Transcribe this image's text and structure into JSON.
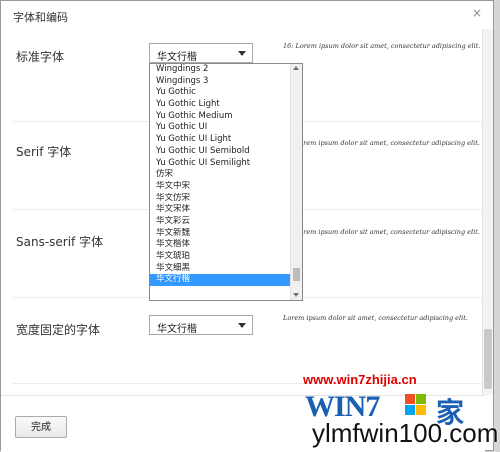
{
  "dialog": {
    "title": "字体和编码",
    "close_glyph": "×",
    "done_label": "完成"
  },
  "sections": {
    "standard": {
      "label": "标准字体",
      "select_value": "华文行楷",
      "sample": "16: Lorem ipsum dolor sit amet, consectetur adipiscing elit."
    },
    "serif": {
      "label": "Serif 字体",
      "sample": "Lorem ipsum dolor sit amet, consectetur adipiscing elit."
    },
    "sans": {
      "label": "Sans-serif 字体",
      "sample": "Lorem ipsum dolor sit amet, consectetur adipiscing elit."
    },
    "fixed": {
      "label": "宽度固定的字体",
      "select_value": "华文行楷",
      "sample": "Lorem ipsum dolor sit amet, consectetur adipiscing elit."
    }
  },
  "dropdown": {
    "items": [
      "Wingdings 2",
      "Wingdings 3",
      "Yu Gothic",
      "Yu Gothic Light",
      "Yu Gothic Medium",
      "Yu Gothic UI",
      "Yu Gothic UI Light",
      "Yu Gothic UI Semibold",
      "Yu Gothic UI Semilight",
      "仿宋",
      "华文中宋",
      "华文仿宋",
      "华文宋体",
      "华文彩云",
      "华文新魏",
      "华文楷体",
      "华文琥珀",
      "华文细黑",
      "华文行楷"
    ],
    "selected_index": 18
  },
  "watermark": {
    "site1": "www.win7zhijia.cn",
    "logo": "WIN7",
    "badge": "家",
    "site2": "ylmfwin100.com"
  },
  "colors": {
    "selection": "#3399ff",
    "watermark_red": "#e00000",
    "watermark_blue": "#1b5fb2"
  }
}
